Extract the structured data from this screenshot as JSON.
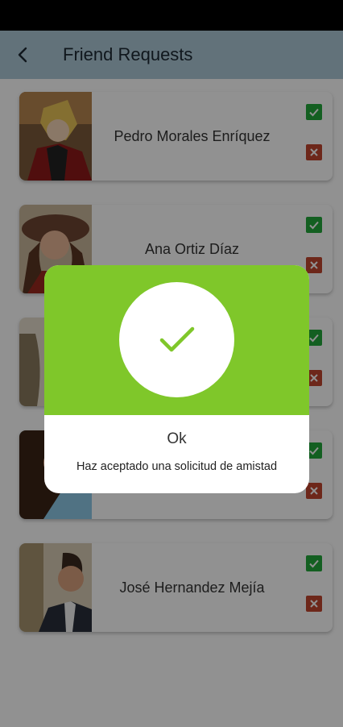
{
  "header": {
    "title": "Friend Requests",
    "back_icon": "chevron-left-icon"
  },
  "requests": [
    {
      "name": "Pedro Morales Enríquez"
    },
    {
      "name": "Ana Ortiz Díaz"
    },
    {
      "name": ""
    },
    {
      "name": ""
    },
    {
      "name": "José Hernandez Mejía"
    }
  ],
  "actions": {
    "accept_icon": "check-icon",
    "decline_icon": "close-icon",
    "accept_color": "#22a83a",
    "decline_color": "#c0462e"
  },
  "dialog": {
    "title": "Ok",
    "message": "Haz aceptado una solicitud de amistad",
    "icon": "check-icon",
    "accent_color": "#7fc72a"
  }
}
